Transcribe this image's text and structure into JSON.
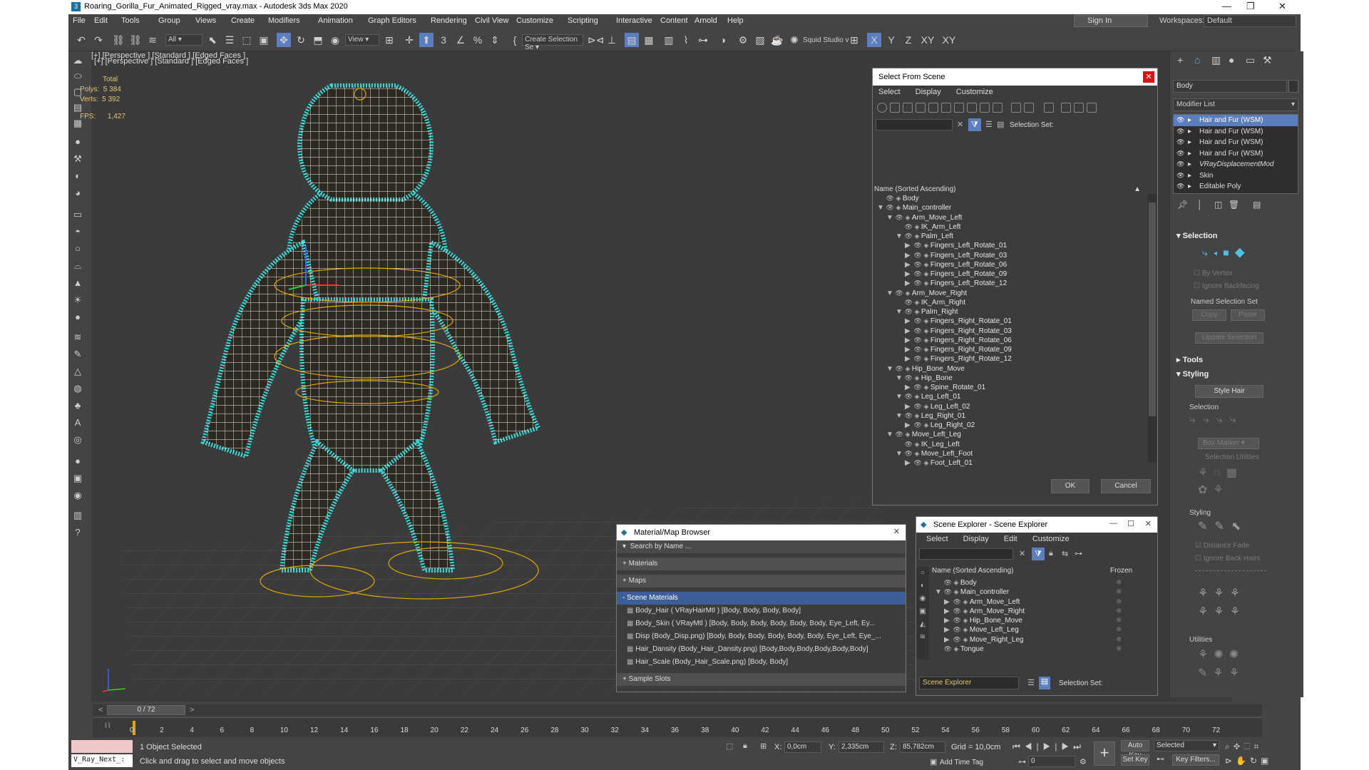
{
  "window": {
    "title": "Roaring_Gorilla_Fur_Animated_Rigged_vray.max - Autodesk 3ds Max 2020"
  },
  "menu": [
    "File",
    "Edit",
    "Tools",
    "Group",
    "Views",
    "Create",
    "Modifiers",
    "Animation",
    "Graph Editors",
    "Rendering",
    "Civil View",
    "Customize",
    "Scripting",
    "Interactive",
    "Content",
    "Arnold",
    "Help"
  ],
  "signin": "Sign In",
  "workspaces_label": "Workspaces:",
  "workspace_value": "Default",
  "toolbar": {
    "filter": "All",
    "view": "View",
    "create_selection": "Create Selection Se",
    "squid": "Squid Studio v",
    "axes": [
      "X",
      "Y",
      "Z",
      "XY",
      "XY"
    ]
  },
  "viewport": {
    "label": "[+] [Perspective ] [Standard ] [Edged Faces ]",
    "stats": {
      "total": "Total",
      "polys_label": "Polys:",
      "polys": "5 384",
      "verts_label": "Verts:",
      "verts": "5 392",
      "fps_label": "FPS:",
      "fps": "1,427"
    }
  },
  "select_dialog": {
    "title": "Select From Scene",
    "menu": [
      "Select",
      "Display",
      "Customize"
    ],
    "selection_set": "Selection Set:",
    "column": "Name (Sorted Ascending)",
    "tree": [
      {
        "level": 0,
        "arrow": "",
        "name": "Body"
      },
      {
        "level": 0,
        "arrow": "▼",
        "name": "Main_controller"
      },
      {
        "level": 1,
        "arrow": "▼",
        "name": "Arm_Move_Left"
      },
      {
        "level": 2,
        "arrow": "",
        "name": "IK_Arm_Left"
      },
      {
        "level": 2,
        "arrow": "▼",
        "name": "Palm_Left"
      },
      {
        "level": 3,
        "arrow": "▶",
        "name": "Fingers_Left_Rotate_01"
      },
      {
        "level": 3,
        "arrow": "▶",
        "name": "Fingers_Left_Rotate_03"
      },
      {
        "level": 3,
        "arrow": "▶",
        "name": "Fingers_Left_Rotate_06"
      },
      {
        "level": 3,
        "arrow": "▶",
        "name": "Fingers_Left_Rotate_09"
      },
      {
        "level": 3,
        "arrow": "▶",
        "name": "Fingers_Left_Rotate_12"
      },
      {
        "level": 1,
        "arrow": "▼",
        "name": "Arm_Move_Right"
      },
      {
        "level": 2,
        "arrow": "",
        "name": "IK_Arm_Right"
      },
      {
        "level": 2,
        "arrow": "▼",
        "name": "Palm_Right"
      },
      {
        "level": 3,
        "arrow": "▶",
        "name": "Fingers_Right_Rotate_01"
      },
      {
        "level": 3,
        "arrow": "▶",
        "name": "Fingers_Right_Rotate_03"
      },
      {
        "level": 3,
        "arrow": "▶",
        "name": "Fingers_Right_Rotate_06"
      },
      {
        "level": 3,
        "arrow": "▶",
        "name": "Fingers_Right_Rotate_09"
      },
      {
        "level": 3,
        "arrow": "▶",
        "name": "Fingers_Right_Rotate_12"
      },
      {
        "level": 1,
        "arrow": "▼",
        "name": "Hip_Bone_Move"
      },
      {
        "level": 2,
        "arrow": "▼",
        "name": "Hip_Bone"
      },
      {
        "level": 3,
        "arrow": "▶",
        "name": "Spine_Rotate_01"
      },
      {
        "level": 2,
        "arrow": "▼",
        "name": "Leg_Left_01"
      },
      {
        "level": 3,
        "arrow": "▶",
        "name": "Leg_Left_02"
      },
      {
        "level": 2,
        "arrow": "▼",
        "name": "Leg_Right_01"
      },
      {
        "level": 3,
        "arrow": "▶",
        "name": "Leg_Right_02"
      },
      {
        "level": 1,
        "arrow": "▼",
        "name": "Move_Left_Leg"
      },
      {
        "level": 2,
        "arrow": "",
        "name": "IK_Leg_Left"
      },
      {
        "level": 2,
        "arrow": "▼",
        "name": "Move_Left_Foot"
      },
      {
        "level": 3,
        "arrow": "▶",
        "name": "Foot_Left_01"
      }
    ],
    "ok": "OK",
    "cancel": "Cancel"
  },
  "material_browser": {
    "title": "Material/Map Browser",
    "search": "Search by Name ...",
    "materials": "+ Materials",
    "maps": "+ Maps",
    "scene_materials": "- Scene Materials",
    "items": [
      "Body_Hair  ( VRayHairMtl ) [Body, Body, Body, Body]",
      "Body_Skin  ( VRayMtl ) [Body, Body, Body, Body, Body, Body, Eye_Left, Ey...",
      "Disp (Body_Disp.png) [Body, Body, Body, Body, Body, Body, Eye_Left, Eye_...",
      "Hair_Dansity (Body_Hair_Dansity.png) [Body,Body,Body,Body,Body,Body]",
      "Hair_Scale (Body_Hair_Scale.png) [Body, Body]"
    ],
    "sample_slots": "+ Sample Slots"
  },
  "scene_explorer": {
    "title": "Scene Explorer - Scene Explorer",
    "menu": [
      "Select",
      "Display",
      "Edit",
      "Customize"
    ],
    "column": "Name (Sorted Ascending)",
    "frozen": "Frozen",
    "tree": [
      {
        "level": 0,
        "arrow": "",
        "name": "Body"
      },
      {
        "level": 0,
        "arrow": "▼",
        "name": "Main_controller"
      },
      {
        "level": 1,
        "arrow": "▶",
        "name": "Arm_Move_Left"
      },
      {
        "level": 1,
        "arrow": "▶",
        "name": "Arm_Move_Right"
      },
      {
        "level": 1,
        "arrow": "▶",
        "name": "Hip_Bone_Move"
      },
      {
        "level": 1,
        "arrow": "▶",
        "name": "Move_Left_Leg"
      },
      {
        "level": 1,
        "arrow": "▶",
        "name": "Move_Right_Leg"
      },
      {
        "level": 0,
        "arrow": "",
        "name": "Tongue"
      }
    ],
    "explorer_name": "Scene Explorer",
    "selection_set": "Selection Set:"
  },
  "command_panel": {
    "object_name": "Body",
    "modifier_list": "Modifier List",
    "modifiers": [
      {
        "name": "Hair and Fur (WSM)",
        "selected": true
      },
      {
        "name": "Hair and Fur (WSM)",
        "selected": false
      },
      {
        "name": "Hair and Fur (WSM)",
        "selected": false
      },
      {
        "name": "Hair and Fur (WSM)",
        "selected": false
      },
      {
        "name": "VRayDisplacementMod",
        "selected": false
      },
      {
        "name": "Skin",
        "selected": false
      },
      {
        "name": "Editable Poly",
        "selected": false
      }
    ],
    "selection": "Selection",
    "by_vertex": "By Vertex",
    "ignore_backfacing": "Ignore Backfacing",
    "named_selection_set": "Named Selection Set",
    "copy": "Copy",
    "paste": "Paste",
    "update_selection": "Update Selection",
    "tools": "Tools",
    "styling": "Styling",
    "style_hair": "Style Hair",
    "selection2": "Selection",
    "box_marker": "Box Marker",
    "selection_utilities": "Selection Utilities",
    "styling2": "Styling",
    "distance_fade": "Distance Fade",
    "ignore_back_hairs": "Ignore Back Hairs",
    "utilities": "Utilities"
  },
  "timeline": {
    "frame": "0 / 72",
    "ticks": [
      "0",
      "2",
      "4",
      "6",
      "8",
      "10",
      "12",
      "14",
      "16",
      "18",
      "20",
      "22",
      "24",
      "26",
      "28",
      "30",
      "32",
      "34",
      "36",
      "38",
      "40",
      "42",
      "44",
      "46",
      "48",
      "50",
      "52",
      "54",
      "56",
      "58",
      "60",
      "62",
      "64",
      "66",
      "68",
      "70",
      "72"
    ]
  },
  "status": {
    "script_box": "V_Ray_Next_:",
    "selected": "1 Object Selected",
    "prompt": "Click and drag to select and move objects",
    "x_label": "X:",
    "x": "0,0cm",
    "y_label": "Y:",
    "y": "2,335cm",
    "z_label": "Z:",
    "z": "85,782cm",
    "grid": "Grid = 10,0cm",
    "add_time_tag": "Add Time Tag",
    "auto_key": "Auto Key",
    "set_key": "Set Key",
    "selected_dd": "Selected",
    "key_filters": "Key Filters...",
    "frame_field": "0"
  },
  "colors": {
    "bg": "#444444",
    "fur": "#2fd4d4",
    "wire": "#ffffff",
    "gizmo": "#e0a800",
    "selection": "#5b7fbe"
  }
}
